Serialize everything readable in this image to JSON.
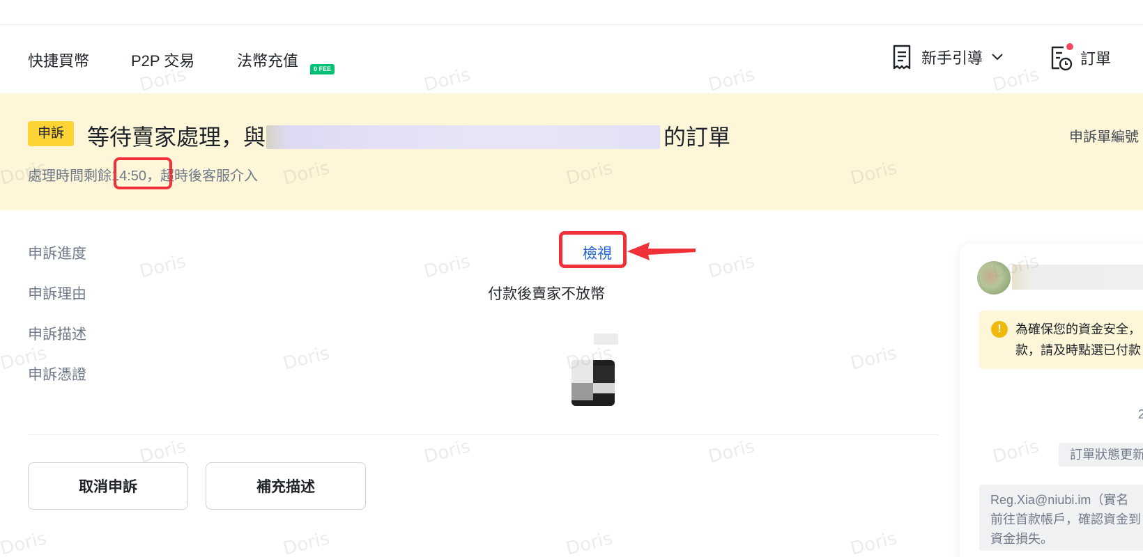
{
  "nav": {
    "items": [
      "快捷買幣",
      "P2P 交易",
      "法幣充值"
    ],
    "fee_badge": "0 FEE",
    "guide_label": "新手引導",
    "orders_label": "訂單"
  },
  "banner": {
    "tag": "申訴",
    "title_prefix": "等待賣家處理，與",
    "title_suffix": "的訂單",
    "right_label": "申訴單編號",
    "sub_prefix": "處理時間剩餘",
    "timer": "14:50",
    "sub_suffix": "，超時後客服介入"
  },
  "details": {
    "progress_label": "申訴進度",
    "progress_action": "檢視",
    "reason_label": "申訴理由",
    "reason_value": "付款後賣家不放幣",
    "description_label": "申訴描述",
    "evidence_label": "申訴憑證"
  },
  "actions": {
    "cancel": "取消申訴",
    "supplement": "補充描述"
  },
  "chat": {
    "warning_line1": "為確保您的資金安全，",
    "warning_line2": "款，請及時點選已付款",
    "time": "2",
    "status": "訂單狀態更新",
    "sys_line1": "Reg.Xia@niubi.im（實名",
    "sys_line2": "前往首款帳戶，確認資金到",
    "sys_line3": "資金損失。"
  },
  "watermark": "Doris",
  "colors": {
    "accent_yellow": "#fcd535",
    "banner_bg": "#fef6d8",
    "link_blue": "#1d5fe0",
    "highlight_red": "#f0313a",
    "fee_green": "#02c076"
  }
}
